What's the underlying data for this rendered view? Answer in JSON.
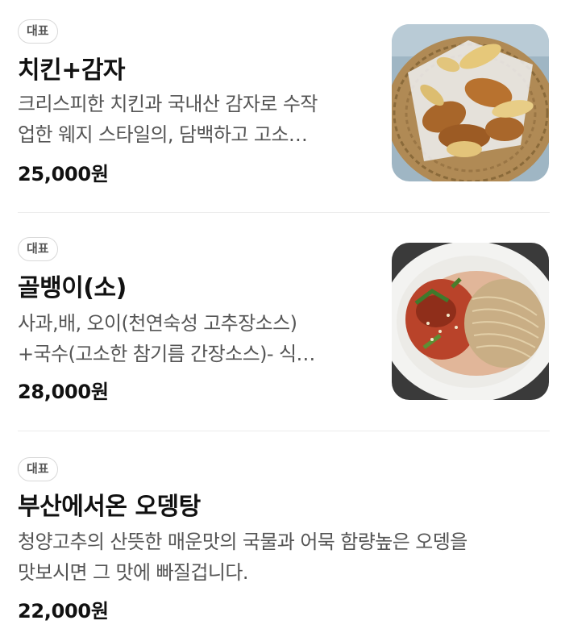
{
  "menu": {
    "items": [
      {
        "badge": "대표",
        "name": "치킨+감자",
        "description_lines": [
          "크리스피한 치킨과 국내산 감자로 수작",
          "업한 웨지 스타일의, 담백하고 고소…"
        ],
        "price": "25,000원",
        "image_icon": "chicken-potato-photo"
      },
      {
        "badge": "대표",
        "name": "골뱅이(소)",
        "description_lines": [
          "사과,배, 오이(천연숙성 고추장소스)",
          "+국수(고소한 참기름 간장소스)- 식…"
        ],
        "price": "28,000원",
        "image_icon": "golbaengi-noodle-photo"
      },
      {
        "badge": "대표",
        "name": "부산에서온 오뎅탕",
        "description_lines": [
          "청양고추의 산뜻한 매운맛의 국물과 어묵 함량높은 오뎅을",
          "맛보시면 그 맛에 빠질겁니다."
        ],
        "price": "22,000원"
      }
    ]
  }
}
